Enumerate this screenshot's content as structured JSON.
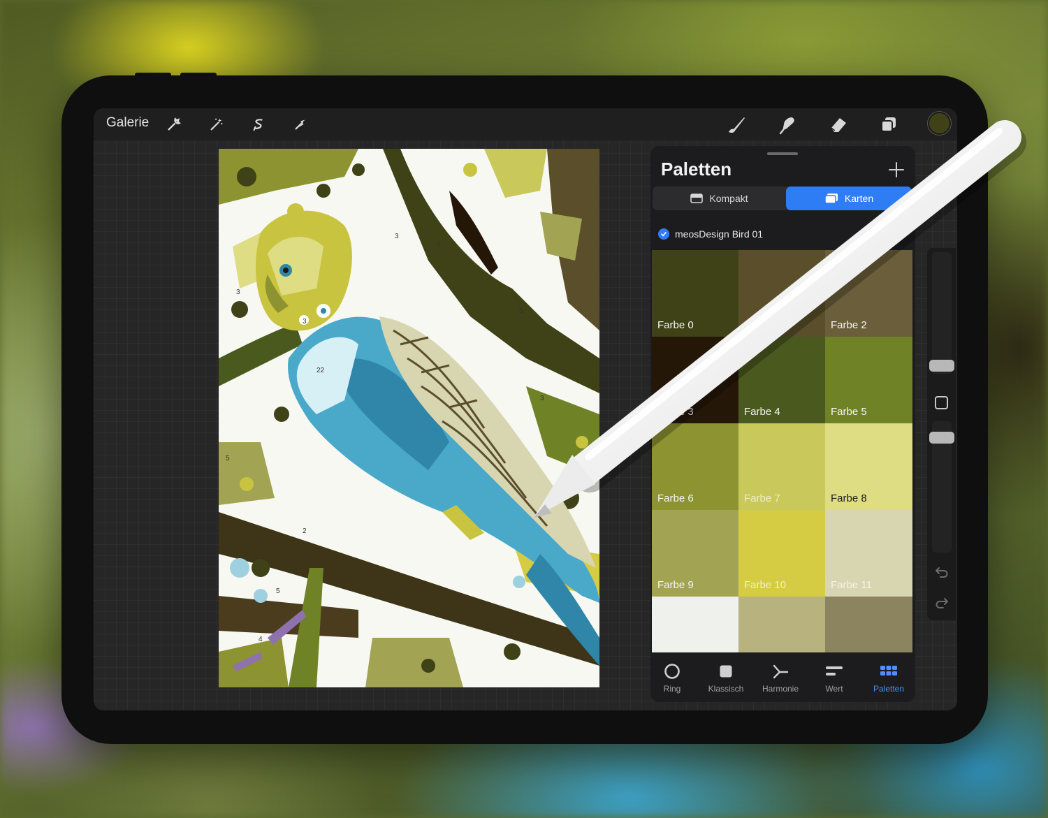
{
  "toolbar": {
    "gallery_label": "Galerie",
    "left_tools": [
      "wrench-icon",
      "magic-wand-icon",
      "selection-icon",
      "transform-arrow-icon"
    ],
    "right_tools": [
      "brush-icon",
      "smudge-icon",
      "eraser-icon",
      "layers-icon"
    ],
    "current_color": "#3f4116"
  },
  "panel": {
    "title": "Paletten",
    "view_modes": [
      {
        "label": "Kompakt",
        "active": false
      },
      {
        "label": "Karten",
        "active": true
      }
    ],
    "palette_name": "meosDesign Bird 01",
    "swatches": [
      {
        "label": "Farbe 0",
        "color": "#3e4216"
      },
      {
        "label": "Farbe 1",
        "color": "#5a4f2a"
      },
      {
        "label": "Farbe 2",
        "color": "#6b5e3b"
      },
      {
        "label": "Farbe 3",
        "color": "#241708"
      },
      {
        "label": "Farbe 4",
        "color": "#4a5a1f"
      },
      {
        "label": "Farbe 5",
        "color": "#6f8226"
      },
      {
        "label": "Farbe 6",
        "color": "#8c9330"
      },
      {
        "label": "Farbe 7",
        "color": "#c9c85a"
      },
      {
        "label": "Farbe 8",
        "color": "#dedd84"
      },
      {
        "label": "Farbe 9",
        "color": "#a2a453"
      },
      {
        "label": "Farbe 10",
        "color": "#d6cc43"
      },
      {
        "label": "Farbe 11",
        "color": "#d8d6b1"
      },
      {
        "label": "",
        "color": "#eef1ec"
      },
      {
        "label": "",
        "color": "#b7b27e"
      },
      {
        "label": "",
        "color": "#8c845f"
      }
    ],
    "bottom_tabs": [
      {
        "label": "Ring",
        "icon": "ring-icon",
        "active": false
      },
      {
        "label": "Klassisch",
        "icon": "square-icon",
        "active": false
      },
      {
        "label": "Harmonie",
        "icon": "harmony-icon",
        "active": false
      },
      {
        "label": "Wert",
        "icon": "value-sliders-icon",
        "active": false
      },
      {
        "label": "Paletten",
        "icon": "palettes-grid-icon",
        "active": true
      }
    ]
  },
  "sidebar": {
    "tools": [
      "brush-size-slider",
      "modify-button",
      "opacity-slider",
      "undo-icon",
      "redo-icon"
    ]
  },
  "colors": {
    "accent": "#2f7df5",
    "bird_blue": "#4aa9c9",
    "bird_yellow": "#c9c440"
  }
}
